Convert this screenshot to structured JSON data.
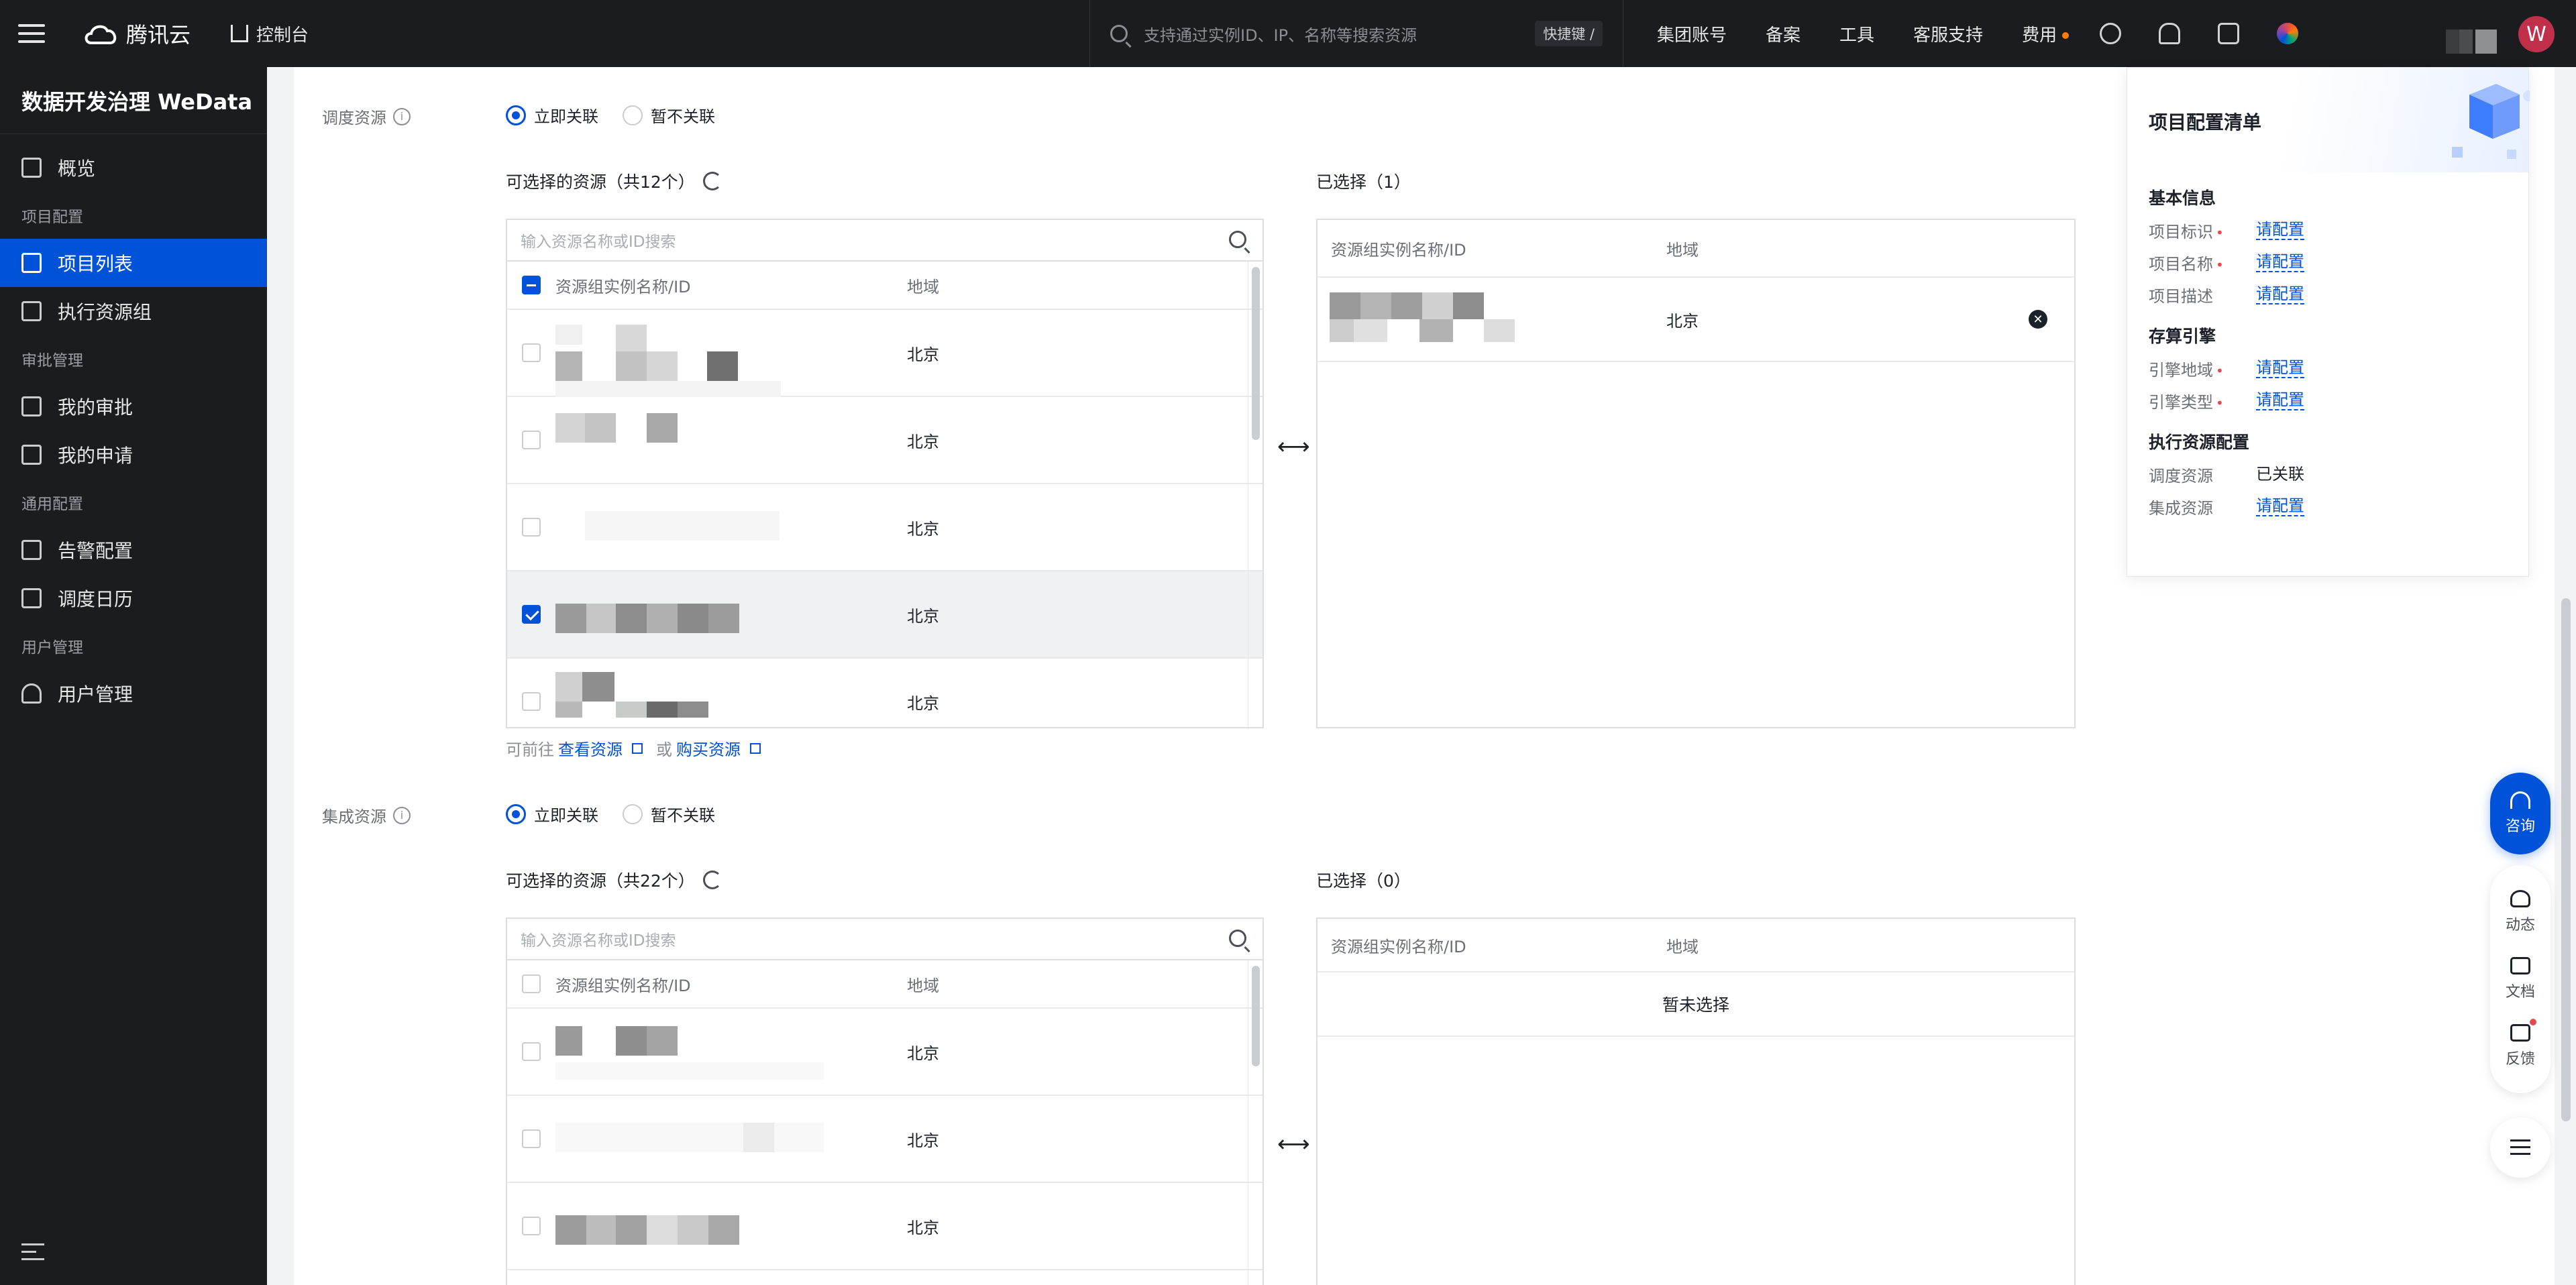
{
  "topbar": {
    "brand": "腾讯云",
    "console": "控制台",
    "search_placeholder": "支持通过实例ID、IP、名称等搜索资源",
    "shortcut": "快捷键 /",
    "links": [
      "集团账号",
      "备案",
      "工具",
      "客服支持",
      "费用"
    ],
    "avatar_letter": "W",
    "icons": [
      "tea-icon",
      "bell-icon",
      "cart-icon",
      "app-icon"
    ],
    "accent_color": "#ff7d00"
  },
  "sidebar": {
    "title": "数据开发治理 WeData",
    "overview": "概览",
    "groups": {
      "project_config": "项目配置",
      "approval": "审批管理",
      "general": "通用配置",
      "users": "用户管理"
    },
    "items": {
      "project_list": "项目列表",
      "exec_group": "执行资源组",
      "my_approval": "我的审批",
      "my_apply": "我的申请",
      "alarm": "告警配置",
      "calendar": "调度日历",
      "user_mgmt": "用户管理"
    },
    "active_color": "#0052d9"
  },
  "schedule": {
    "label": "调度资源",
    "radio_on": "立即关联",
    "radio_off": "暂不关联",
    "available_title": "可选择的资源（共12个）",
    "search_placeholder": "输入资源名称或ID搜索",
    "col_name": "资源组实例名称/ID",
    "col_region": "地域",
    "rows": [
      {
        "region": "北京",
        "checked": false
      },
      {
        "region": "北京",
        "checked": false
      },
      {
        "region": "北京",
        "checked": false
      },
      {
        "region": "北京",
        "checked": true
      },
      {
        "region": "北京",
        "checked": false
      }
    ],
    "helper_prefix": "可前往",
    "helper_link1": "查看资源",
    "helper_or": "或",
    "helper_link2": "购买资源",
    "selected_title": "已选择（1）",
    "selected_rows": [
      {
        "region": "北京"
      }
    ]
  },
  "integration": {
    "label": "集成资源",
    "radio_on": "立即关联",
    "radio_off": "暂不关联",
    "available_title": "可选择的资源（共22个）",
    "search_placeholder": "输入资源名称或ID搜索",
    "col_name": "资源组实例名称/ID",
    "col_region": "地域",
    "rows": [
      {
        "region": "北京",
        "checked": false
      },
      {
        "region": "北京",
        "checked": false
      },
      {
        "region": "北京",
        "checked": false
      }
    ],
    "selected_title": "已选择（0）",
    "empty_text": "暂未选择"
  },
  "checklist": {
    "title": "项目配置清单",
    "basic": "基本信息",
    "basic_rows": [
      {
        "key": "项目标识",
        "required": true,
        "val": "请配置"
      },
      {
        "key": "项目名称",
        "required": true,
        "val": "请配置"
      },
      {
        "key": "项目描述",
        "required": false,
        "val": "请配置"
      }
    ],
    "engine": "存算引擎",
    "engine_rows": [
      {
        "key": "引擎地域",
        "required": true,
        "val": "请配置"
      },
      {
        "key": "引擎类型",
        "required": true,
        "val": "请配置"
      }
    ],
    "exec": "执行资源配置",
    "exec_rows": [
      {
        "key": "调度资源",
        "required": false,
        "val": "已关联"
      },
      {
        "key": "集成资源",
        "required": false,
        "val": "请配置"
      }
    ]
  },
  "rail": {
    "consult": "咨询",
    "news": "动态",
    "docs": "文档",
    "feedback": "反馈"
  }
}
